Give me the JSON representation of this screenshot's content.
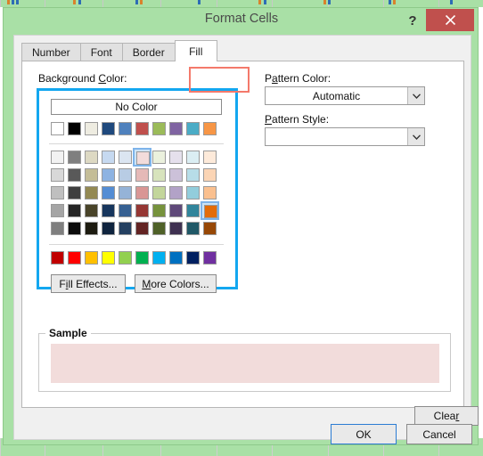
{
  "window": {
    "title": "Format Cells",
    "help_icon": "?",
    "close_icon": "close-icon",
    "titlebar_color": "#A9E0A6",
    "close_button_color": "#C0504D"
  },
  "tabs": [
    {
      "label": "Number",
      "active": false
    },
    {
      "label": "Font",
      "active": false
    },
    {
      "label": "Border",
      "active": false
    },
    {
      "label": "Fill",
      "active": true
    }
  ],
  "annotation": {
    "target": "Fill",
    "color": "#F4796B"
  },
  "background_color": {
    "label": "Background Color:",
    "label_accel": "C",
    "no_color_label": "No Color",
    "highlight_border": "#13A7F0",
    "theme_colors": [
      "#FFFFFF",
      "#000000",
      "#EEECE1",
      "#1F497D",
      "#4F81BD",
      "#C0504D",
      "#9BBB59",
      "#8064A2",
      "#4BACC6",
      "#F79646"
    ],
    "theme_variants": [
      [
        "#F2F2F2",
        "#7F7F7F",
        "#DDD9C3",
        "#C6D9F0",
        "#DBE5F1",
        "#F2DCDB",
        "#EBF1DD",
        "#E5E0EC",
        "#DBEEF3",
        "#FDEADA"
      ],
      [
        "#D8D8D8",
        "#595959",
        "#C4BD97",
        "#8DB3E2",
        "#B8CCE4",
        "#E5B9B7",
        "#D7E3BC",
        "#CCC1D9",
        "#B7DDE8",
        "#FBD5B5"
      ],
      [
        "#BFBFBF",
        "#3F3F3F",
        "#938953",
        "#548DD4",
        "#95B3D7",
        "#D99694",
        "#C3D69B",
        "#B2A2C7",
        "#92CDDC",
        "#FAC08F"
      ],
      [
        "#A5A5A5",
        "#262626",
        "#494429",
        "#17365D",
        "#366092",
        "#953734",
        "#76923C",
        "#5F497A",
        "#31859B",
        "#E36C09"
      ],
      [
        "#7F7F7F",
        "#0C0C0C",
        "#1D1B10",
        "#0F243E",
        "#244061",
        "#632423",
        "#4F6128",
        "#3F3151",
        "#205867",
        "#974806"
      ]
    ],
    "standard_colors": [
      "#C00000",
      "#FF0000",
      "#FFC000",
      "#FFFF00",
      "#92D050",
      "#00B050",
      "#00B0F0",
      "#0070C0",
      "#002060",
      "#7030A0"
    ],
    "selected_swatch": {
      "row": 0,
      "col": 5,
      "color": "#F2DCDB"
    },
    "hovered_swatch": {
      "row": 3,
      "col": 9,
      "color": "#E36C09"
    },
    "fill_effects_label": "Fill Effects...",
    "fill_effects_accel": "i",
    "more_colors_label": "More Colors...",
    "more_colors_accel": "M"
  },
  "pattern": {
    "color_label": "Pattern Color:",
    "color_accel": "a",
    "color_value": "Automatic",
    "style_label": "Pattern Style:",
    "style_accel": "P",
    "style_value": ""
  },
  "sample": {
    "legend": "Sample",
    "fill_color": "#F2DCDB"
  },
  "buttons": {
    "clear": "Clear",
    "clear_accel": "r",
    "ok": "OK",
    "cancel": "Cancel"
  }
}
